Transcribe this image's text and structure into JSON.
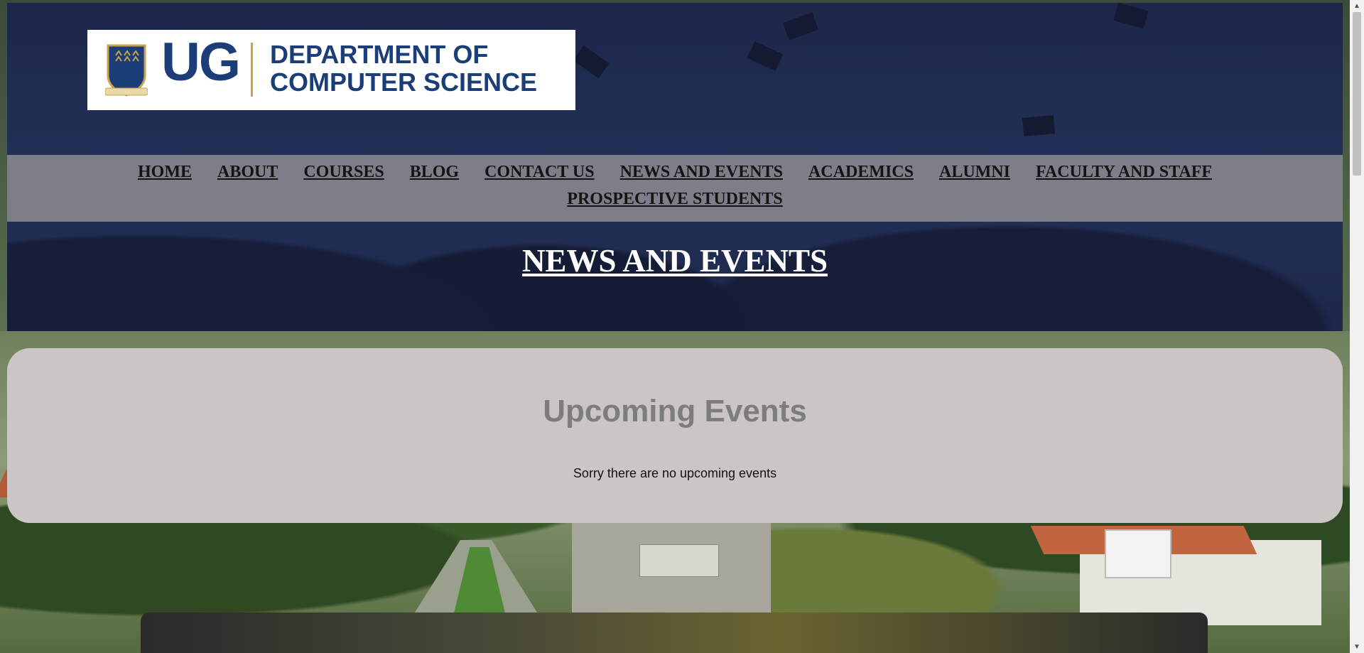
{
  "header": {
    "logo": {
      "ug": "UG",
      "department_line1": "DEPARTMENT OF",
      "department_line2": "COMPUTER SCIENCE",
      "brand_color": "#1c3e78",
      "accent_color": "#c9a24b"
    },
    "nav": {
      "row1": [
        "HOME",
        "ABOUT",
        "COURSES",
        "BLOG",
        "CONTACT US",
        "NEWS AND EVENTS",
        "ACADEMICS",
        "ALUMNI",
        "FACULTY AND STAFF"
      ],
      "row2": [
        "PROSPECTIVE STUDENTS"
      ]
    },
    "page_title": "NEWS AND EVENTS"
  },
  "events": {
    "heading": "Upcoming Events",
    "empty_message": "Sorry there are no upcoming events"
  },
  "icons": {
    "scroll_up": "scroll-up-arrow-icon",
    "scroll_down": "scroll-down-arrow-icon"
  },
  "colors": {
    "hero_overlay": "#1e2e5a",
    "navbar_bg": "#969696",
    "card_bg": "#cbc6c5",
    "card_heading": "#7e7c7c"
  }
}
